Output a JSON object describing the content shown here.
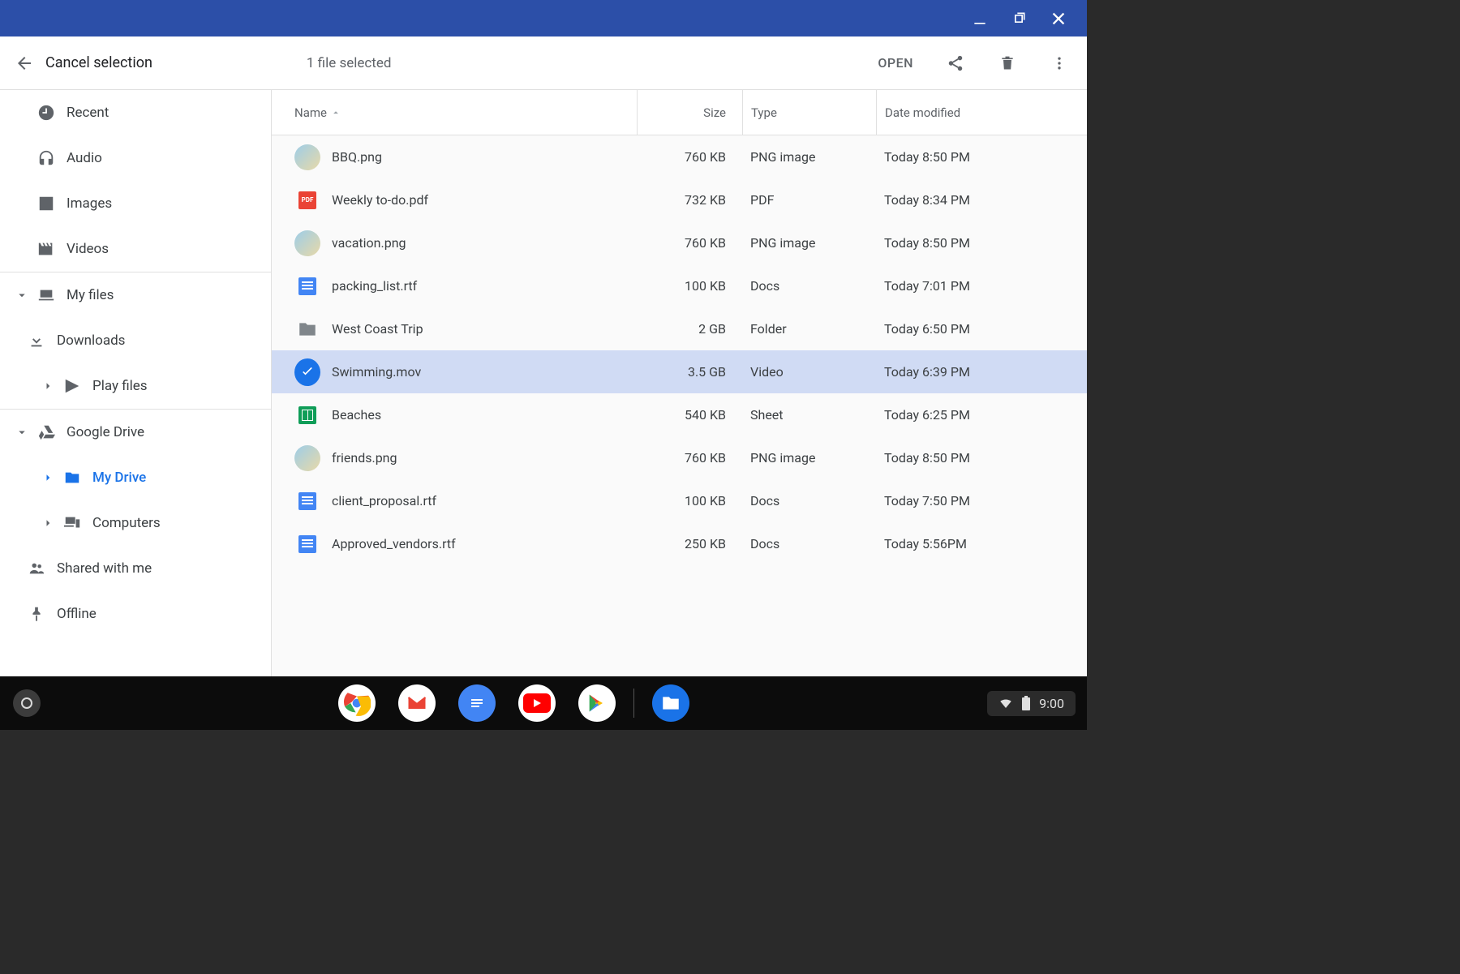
{
  "toolbar": {
    "cancel_label": "Cancel selection",
    "selected_label": "1 file selected",
    "open_label": "OPEN"
  },
  "sidebar": {
    "quick": [
      {
        "label": "Recent",
        "icon": "clock"
      },
      {
        "label": "Audio",
        "icon": "audio"
      },
      {
        "label": "Images",
        "icon": "images"
      },
      {
        "label": "Videos",
        "icon": "videos"
      }
    ],
    "myfiles": {
      "label": "My files",
      "children": [
        {
          "label": "Downloads",
          "icon": "download"
        },
        {
          "label": "Play files",
          "icon": "play"
        }
      ]
    },
    "drive": {
      "label": "Google Drive",
      "children": [
        {
          "label": "My Drive",
          "icon": "drive",
          "active": true
        },
        {
          "label": "Computers",
          "icon": "computers"
        },
        {
          "label": "Shared with me",
          "icon": "shared"
        },
        {
          "label": "Offline",
          "icon": "offline"
        }
      ]
    }
  },
  "columns": {
    "name": "Name",
    "size": "Size",
    "type": "Type",
    "date": "Date modified"
  },
  "files": [
    {
      "name": "BBQ.png",
      "size": "760 KB",
      "type": "PNG image",
      "date": "Today 8:50 PM",
      "icon": "thumb"
    },
    {
      "name": "Weekly to-do.pdf",
      "size": "732 KB",
      "type": "PDF",
      "date": "Today 8:34 PM",
      "icon": "pdf"
    },
    {
      "name": "vacation.png",
      "size": "760 KB",
      "type": "PNG image",
      "date": "Today 8:50 PM",
      "icon": "thumb"
    },
    {
      "name": "packing_list.rtf",
      "size": "100 KB",
      "type": "Docs",
      "date": "Today 7:01 PM",
      "icon": "doc"
    },
    {
      "name": "West Coast Trip",
      "size": "2 GB",
      "type": "Folder",
      "date": "Today 6:50 PM",
      "icon": "folder"
    },
    {
      "name": "Swimming.mov",
      "size": "3.5 GB",
      "type": "Video",
      "date": "Today 6:39 PM",
      "icon": "check",
      "selected": true
    },
    {
      "name": "Beaches",
      "size": "540 KB",
      "type": "Sheet",
      "date": "Today 6:25 PM",
      "icon": "sheet"
    },
    {
      "name": "friends.png",
      "size": "760 KB",
      "type": "PNG image",
      "date": "Today 8:50 PM",
      "icon": "thumb"
    },
    {
      "name": "client_proposal.rtf",
      "size": "100 KB",
      "type": "Docs",
      "date": "Today 7:50 PM",
      "icon": "doc"
    },
    {
      "name": "Approved_vendors.rtf",
      "size": "250 KB",
      "type": "Docs",
      "date": "Today 5:56PM",
      "icon": "doc"
    }
  ],
  "shelf": {
    "time": "9:00"
  },
  "icons": {
    "pdf_text": "PDF"
  }
}
